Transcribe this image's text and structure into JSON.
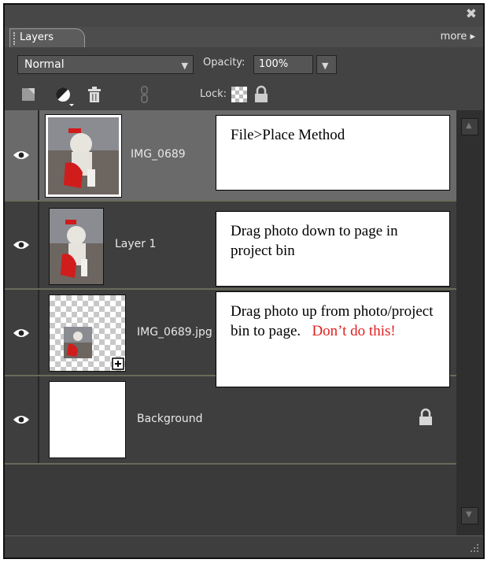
{
  "panel": {
    "close_symbol": "✖",
    "tab_label": "Layers",
    "more_label": "more ▸"
  },
  "options": {
    "blend_mode": "Normal",
    "opacity_label": "Opacity:",
    "opacity_value": "100%",
    "lock_label": "Lock:"
  },
  "layers": [
    {
      "name": "IMG_0689",
      "visible": true,
      "selected": true,
      "thumb_icon": "photo-thumbnail-icon",
      "note": {
        "text": "File>Place Method",
        "warning": ""
      }
    },
    {
      "name": "Layer 1",
      "visible": true,
      "selected": false,
      "thumb_icon": "photo-thumbnail-icon",
      "note": {
        "text": "Drag photo down to page in project bin",
        "warning": ""
      }
    },
    {
      "name": "IMG_0689.jpg",
      "visible": true,
      "selected": false,
      "thumb_icon": "smart-object-thumbnail-icon",
      "note": {
        "text": "Drag photo up from photo/project bin to page.",
        "warning": "Don’t do this!"
      }
    },
    {
      "name": "Background",
      "visible": true,
      "selected": false,
      "locked": true,
      "thumb_icon": "white-thumbnail-icon"
    }
  ],
  "icons": {
    "new_layer": "new-layer-icon",
    "adjustment": "adjustment-layer-icon",
    "delete": "trash-icon",
    "link": "link-icon",
    "lock_transparency": "lock-transparency-icon",
    "lock_all": "padlock-icon",
    "eye": "eye-icon",
    "smart_object": "smart-object-badge-icon"
  },
  "colors": {
    "panel_bg": "#3b3b3b",
    "selected_row": "#6a6a6a",
    "divider": "#6a6a5a",
    "warning_text": "#e02020"
  }
}
